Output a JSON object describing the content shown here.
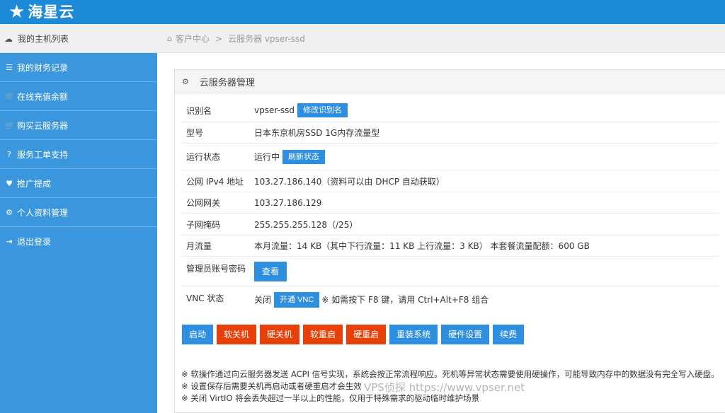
{
  "header": {
    "logo_star": "★",
    "logo_name": "海星云"
  },
  "side_head": {
    "icon": "cloud-icon",
    "label": "我的主机列表"
  },
  "breadcrumb": {
    "home": "客户中心",
    "separator": ">",
    "current": "云服务器 vpser-ssd"
  },
  "sidebar": {
    "items": [
      {
        "icon": "list-icon",
        "glyph": "☰",
        "label": "我的财务记录"
      },
      {
        "icon": "cart-icon",
        "glyph": "🛒",
        "label": "在线充值余额"
      },
      {
        "icon": "cart-icon",
        "glyph": "🛒",
        "label": "购买云服务器"
      },
      {
        "icon": "question-icon",
        "glyph": "?",
        "label": "服务工单支持"
      },
      {
        "icon": "heart-icon",
        "glyph": "♥",
        "label": "推广提成"
      },
      {
        "icon": "gear-icon",
        "glyph": "⚙",
        "label": "个人资料管理"
      },
      {
        "icon": "logout-icon",
        "glyph": "⇥",
        "label": "退出登录"
      }
    ]
  },
  "panel": {
    "title": "云服务器管理",
    "rows": {
      "alias": {
        "label": "识别名",
        "value": "vpser-ssd",
        "button": "修改识别名"
      },
      "model": {
        "label": "型号",
        "value": "日本东京机房SSD 1G内存流量型"
      },
      "status": {
        "label": "运行状态",
        "value": "运行中",
        "button": "刷新状态"
      },
      "ipv4": {
        "label": "公网 IPv4 地址",
        "value": "103.27.186.140（资料可以由 DHCP 自动获取）"
      },
      "gateway": {
        "label": "公网网关",
        "value": "103.27.186.129"
      },
      "netmask": {
        "label": "子网掩码",
        "value": "255.255.255.128（/25）"
      },
      "traffic": {
        "label": "月流量",
        "value": "本月流量：14 KB（其中下行流量：11 KB 上行流量：3 KB） 本套餐流量配额：600 GB"
      },
      "admin_password": {
        "label": "管理员账号密码",
        "button": "查看"
      },
      "vnc": {
        "label": "VNC 状态",
        "value": "关闭",
        "button": "开通 VNC",
        "note": "※ 如需按下 F8 键，请用 Ctrl+Alt+F8 组合"
      }
    },
    "actions": [
      {
        "label": "启动",
        "color": "#2e8ee0"
      },
      {
        "label": "软关机",
        "color": "#e9400a"
      },
      {
        "label": "硬关机",
        "color": "#e9400a"
      },
      {
        "label": "软重启",
        "color": "#e9400a"
      },
      {
        "label": "硬重启",
        "color": "#e9400a"
      },
      {
        "label": "重装系统",
        "color": "#2e8ee0"
      },
      {
        "label": "硬件设置",
        "color": "#2e8ee0"
      },
      {
        "label": "续费",
        "color": "#2e8ee0"
      }
    ],
    "notes": [
      "※ 软操作通过向云服务器发送 ACPI 信号实现，系统会按正常流程响应。死机等异常状态需要使用硬操作，可能导致内存中的数据没有完全写入硬盘。",
      "※ 设置保存后需要关机再启动或者硬重启才会生效",
      "※ 关闭 VirtIO 将会丢失超过一半以上的性能，仅用于特殊需求的驱动临时维护场景"
    ]
  },
  "watermark": "VPS侦探 https://www.vpser.net"
}
